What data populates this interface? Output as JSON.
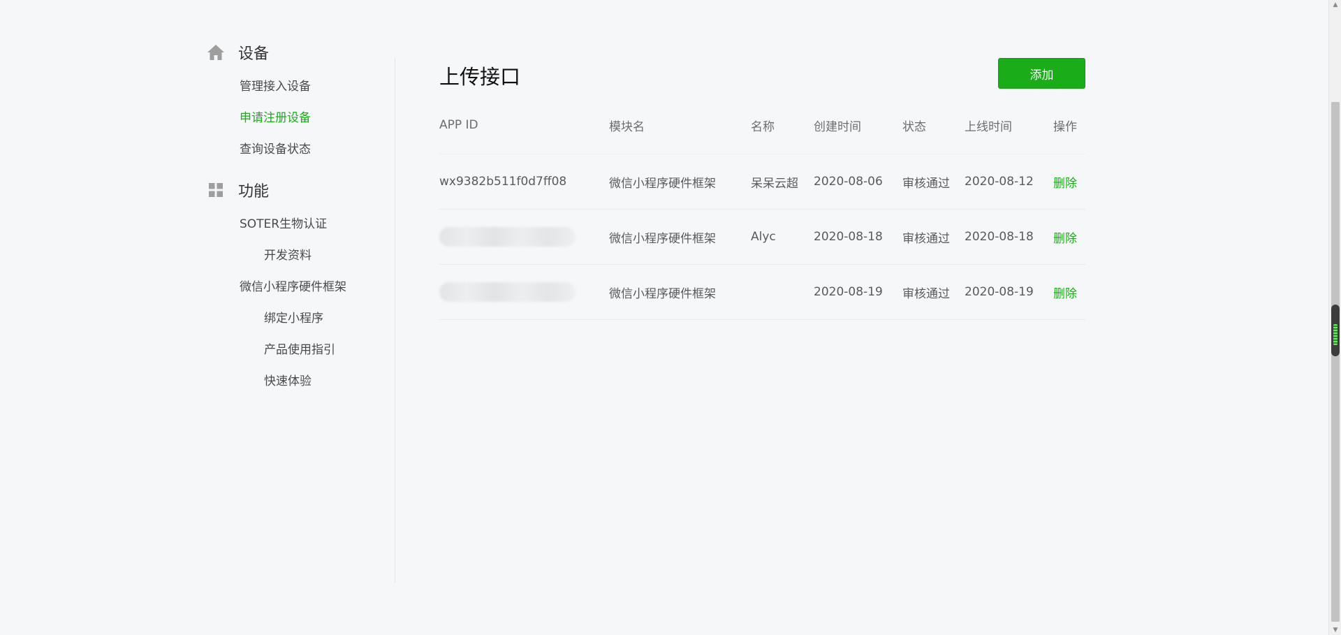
{
  "sidebar": {
    "groups": [
      {
        "title": "设备",
        "icon": "home-icon",
        "items": [
          {
            "label": "管理接入设备",
            "active": false
          },
          {
            "label": "申请注册设备",
            "active": true
          },
          {
            "label": "查询设备状态",
            "active": false
          }
        ]
      },
      {
        "title": "功能",
        "icon": "grid-icon",
        "items": [
          {
            "label": "SOTER生物认证"
          },
          {
            "label": "开发资料"
          },
          {
            "label": "微信小程序硬件框架"
          },
          {
            "label": "绑定小程序"
          },
          {
            "label": "产品使用指引"
          },
          {
            "label": "快速体验"
          }
        ]
      }
    ]
  },
  "main": {
    "title": "上传接口",
    "add_button": "添加",
    "table": {
      "headers": [
        "APP ID",
        "模块名",
        "名称",
        "创建时间",
        "状态",
        "上线时间",
        "操作"
      ],
      "rows": [
        {
          "app_id": "wx9382b511f0d7ff08",
          "module": "微信小程序硬件框架",
          "name": "呆呆云超",
          "created": "2020-08-06",
          "status": "审核通过",
          "online": "2020-08-12",
          "action": "删除"
        },
        {
          "app_id": "",
          "module": "微信小程序硬件框架",
          "name": "Alyc",
          "created": "2020-08-18",
          "status": "审核通过",
          "online": "2020-08-18",
          "action": "删除"
        },
        {
          "app_id": "",
          "module": "微信小程序硬件框架",
          "name": "",
          "created": "2020-08-19",
          "status": "审核通过",
          "online": "2020-08-19",
          "action": "删除"
        }
      ]
    }
  },
  "colors": {
    "accent": "#1aad19",
    "background": "#f6f7f9"
  }
}
